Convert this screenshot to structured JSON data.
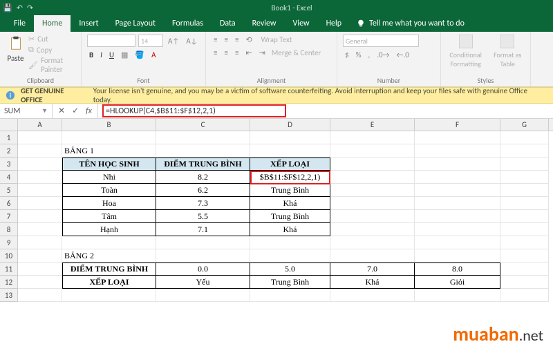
{
  "app": {
    "title": "Book1 - Excel"
  },
  "tabs": {
    "file": "File",
    "home": "Home",
    "insert": "Insert",
    "pagelayout": "Page Layout",
    "formulas": "Formulas",
    "data": "Data",
    "review": "Review",
    "view": "View",
    "help": "Help",
    "tell": "Tell me what you want to do"
  },
  "ribbon": {
    "paste": "Paste",
    "cut": "Cut",
    "copy": "Copy",
    "painter": "Format Painter",
    "clipboard_label": "Clipboard",
    "font_label": "Font",
    "align_label": "Alignment",
    "number_label": "Number",
    "styles_label": "Styles",
    "fontsize": "14",
    "wrap": "Wrap Text",
    "merge": "Merge & Center",
    "numfmt": "General",
    "cond": "Conditional Formatting",
    "fmtas": "Format as Table"
  },
  "warning": {
    "title": "GET GENUINE OFFICE",
    "text": "Your license isn't genuine, and you may be a victim of software counterfeiting. Avoid interruption and keep your files safe with genuine Office today."
  },
  "namebox": "SUM",
  "formula": "=HLOOKUP(C4,$B$11:$F$12,2,1)",
  "cols": {
    "A": "A",
    "B": "B",
    "C": "C",
    "D": "D",
    "E": "E",
    "F": "F",
    "G": "G"
  },
  "rows": [
    "1",
    "2",
    "3",
    "4",
    "5",
    "6",
    "7",
    "8",
    "9",
    "10",
    "11",
    "12",
    "13"
  ],
  "sheet": {
    "b2": "BẢNG 1",
    "b3": "TÊN HỌC SINH",
    "c3": "ĐIỂM TRUNG BÌNH",
    "d3": "XẾP LOẠI",
    "b4": "Nhi",
    "c4": "8.2",
    "d4": "$B$11:$F$12,2,1)",
    "b5": "Toàn",
    "c5": "6.2",
    "d5": "Trung Bình",
    "b6": "Hoa",
    "c6": "7.3",
    "d6": "Khá",
    "b7": "Tâm",
    "c7": "5.5",
    "d7": "Trung Bình",
    "b8": "Hạnh",
    "c8": "7.1",
    "d8": "Khá",
    "b10": "BẢNG 2",
    "b11": "ĐIỂM TRUNG BÌNH",
    "c11": "0.0",
    "d11": "5.0",
    "e11": "7.0",
    "f11": "8.0",
    "b12": "XẾP LOẠI",
    "c12": "Yếu",
    "d12": "Trung Bình",
    "e12": "Khá",
    "f12": "Giỏi"
  },
  "watermark": {
    "brand": "muaban",
    "suffix": ".net"
  }
}
